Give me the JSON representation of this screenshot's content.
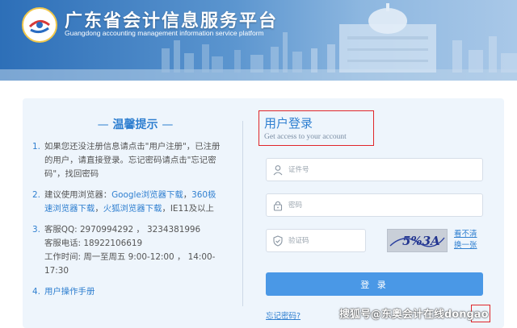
{
  "header": {
    "title": "广东省会计信息服务平台",
    "subtitle": "Guangdong accounting management information service platform"
  },
  "tips": {
    "title": "温馨提示",
    "title_dash": "—",
    "items": [
      {
        "num": "1.",
        "lines": [
          "如果您还没注册信息请点击\"用户注册\"，已注册",
          "的用户，请直接登录。忘记密码请点击\"忘记密",
          "码\"，找回密码"
        ]
      },
      {
        "num": "2.",
        "line1_prefix": "建议使用浏览器：",
        "google_link": "Google浏览器下载",
        "comma1": "，",
        "browser360_link_a": "360极",
        "browser360_link_b": "速浏览器下载",
        "comma2": "，",
        "firefox_link": "火狐浏览器下载",
        "ie_text": "，IE11及以上"
      },
      {
        "num": "3.",
        "lines": [
          "客服QQ: 2970994292 ， 3234381996",
          "客服电话: 18922106619",
          "工作时间: 周一至周五 9:00-12:00 ，  14:00-",
          "17:30"
        ]
      },
      {
        "num": "4.",
        "link": "用户操作手册"
      }
    ]
  },
  "login": {
    "title": "用户登录",
    "subtitle": "Get access to your account",
    "username_placeholder": "证件号",
    "password_placeholder": "密码",
    "captcha_placeholder": "验证码",
    "captcha_text": "5%3A",
    "refresh_line1": "看不清",
    "refresh_line2": "换一张",
    "submit_label": "登 录",
    "forgot_label": "忘记密码?"
  },
  "watermark": "搜狐号@东奥会计在线dongao",
  "colors": {
    "accent": "#2f7fd0",
    "button": "#4a98e6",
    "highlight": "#e0262a",
    "panel": "#eef5fc"
  },
  "icons": {
    "username": "user-icon",
    "password": "lock-icon",
    "captcha": "shield-icon"
  }
}
